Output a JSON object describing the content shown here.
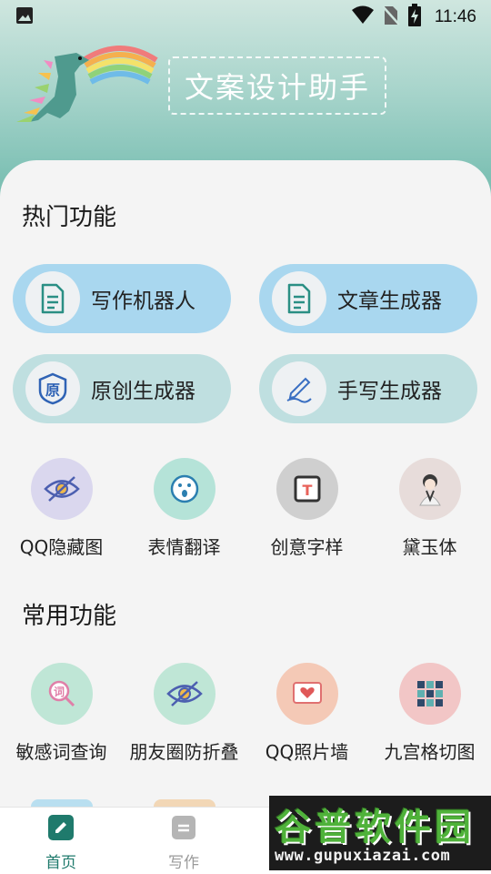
{
  "status_bar": {
    "time": "11:46",
    "icons": [
      "image-icon",
      "wifi-icon",
      "no-sim-icon",
      "battery-charging-icon"
    ]
  },
  "header": {
    "title": "文案设计助手",
    "illustration": "rainbow-dinosaur-illustration"
  },
  "hot_section": {
    "title": "热门功能",
    "pills": [
      {
        "label": "写作机器人",
        "icon": "document-icon",
        "color": "#a9d7ef"
      },
      {
        "label": "文章生成器",
        "icon": "document-icon",
        "color": "#a9d7ef"
      },
      {
        "label": "原创生成器",
        "icon": "original-badge-icon",
        "color": "#bfdfe0"
      },
      {
        "label": "手写生成器",
        "icon": "pen-icon",
        "color": "#bfdfe0"
      }
    ],
    "grid": [
      {
        "label": "QQ隐藏图",
        "icon": "eye-hidden-icon",
        "bg": "#dad7ee"
      },
      {
        "label": "表情翻译",
        "icon": "emoji-icon",
        "bg": "#b5e3d8"
      },
      {
        "label": "创意字样",
        "icon": "text-frame-icon",
        "bg": "#cfcfcf"
      },
      {
        "label": "黛玉体",
        "icon": "girl-avatar-icon",
        "bg": "#e7dcda"
      }
    ]
  },
  "common_section": {
    "title": "常用功能",
    "grid": [
      {
        "label": "敏感词查询",
        "icon": "word-search-icon",
        "bg": "#bfe6d6"
      },
      {
        "label": "朋友圈防折叠",
        "icon": "eye-hidden-icon",
        "bg": "#bfe6d6"
      },
      {
        "label": "QQ照片墙",
        "icon": "photo-heart-icon",
        "bg": "#f4c9b6"
      },
      {
        "label": "九宫格切图",
        "icon": "grid-icon",
        "bg": "#f2c6c6"
      }
    ]
  },
  "bottom_nav": {
    "items": [
      {
        "label": "首页",
        "icon": "home-edit-icon",
        "active": true
      },
      {
        "label": "写作",
        "icon": "write-doc-icon",
        "active": false
      }
    ],
    "active_color": "#1f7a6c",
    "inactive_color": "#9a9a9a"
  },
  "watermark": {
    "title": "谷普软件园",
    "url": "www.gupuxiazai.com"
  }
}
